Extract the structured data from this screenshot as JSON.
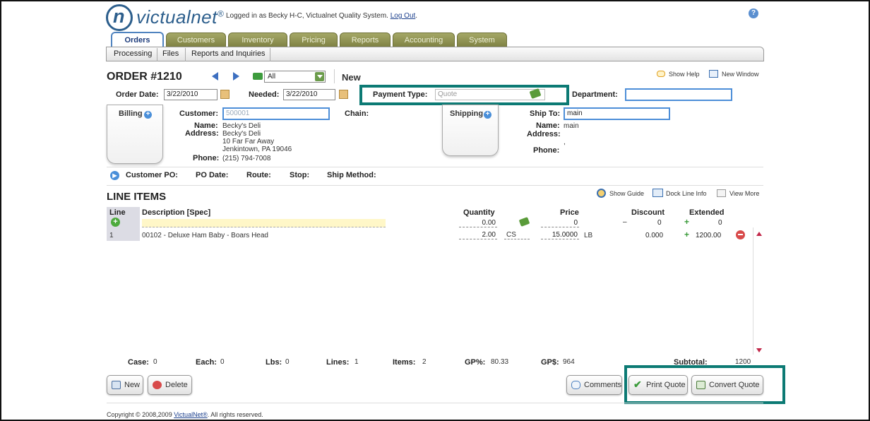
{
  "header": {
    "logo_n": "n",
    "logo_text": "victualnet",
    "logo_reg": "®",
    "login_text": "Logged in as Becky H-C, Victualnet Quality System.",
    "logout_label": "Log Out",
    "help_glyph": "?"
  },
  "tabs": [
    {
      "label": "Orders",
      "active": true
    },
    {
      "label": "Customers"
    },
    {
      "label": "Inventory"
    },
    {
      "label": "Pricing"
    },
    {
      "label": "Reports"
    },
    {
      "label": "Accounting"
    },
    {
      "label": "System"
    }
  ],
  "subnav": [
    "Processing",
    "Files",
    "Reports and Inquiries"
  ],
  "order": {
    "title": "ORDER #1210",
    "filter_value": "All",
    "status": "New",
    "show_help": "Show Help",
    "new_window": "New Window",
    "order_date_label": "Order Date:",
    "order_date": "3/22/2010",
    "needed_label": "Needed:",
    "needed": "3/22/2010",
    "payment_type_label": "Payment Type:",
    "payment_type_placeholder": "Quote",
    "department_label": "Department:",
    "department": ""
  },
  "billing": {
    "tab_label": "Billing",
    "customer_label": "Customer:",
    "customer_placeholder": "500001",
    "name_label": "Name:",
    "name": "Becky's Deli",
    "address_label": "Address:",
    "address_1": "Becky's Deli",
    "address_2": "10 Far Far Away",
    "address_3": "Jenkintown, PA 19046",
    "phone_label": "Phone:",
    "phone": "(215) 794-7008",
    "chain_label": "Chain:"
  },
  "shipping": {
    "tab_label": "Shipping",
    "ship_to_label": "Ship To:",
    "ship_to": "main",
    "name_label": "Name:",
    "name": "main",
    "address_label": "Address:",
    "address_value": ",",
    "phone_label": "Phone:"
  },
  "extra_fields": {
    "customer_po": "Customer PO:",
    "po_date": "PO Date:",
    "route": "Route:",
    "stop": "Stop:",
    "ship_method": "Ship Method:"
  },
  "line_items": {
    "title": "LINE ITEMS",
    "show_guide": "Show Guide",
    "dock_line_info": "Dock Line Info",
    "view_more": "View More",
    "columns": {
      "line": "Line",
      "description": "Description [Spec]",
      "quantity": "Quantity",
      "price": "Price",
      "discount": "Discount",
      "extended": "Extended"
    },
    "new_row": {
      "quantity": "0.00",
      "price": "0",
      "discount_sign": "–",
      "discount": "0",
      "extended": "0"
    },
    "rows": [
      {
        "line": "1",
        "description": "00102 - Deluxe Ham Baby - Boars Head",
        "quantity": "2.00",
        "unit": "CS",
        "price": "15.0000",
        "price_unit": "LB",
        "discount": "0.000",
        "extended": "1200.00"
      }
    ]
  },
  "totals": {
    "case_label": "Case:",
    "case": "0",
    "each_label": "Each:",
    "each": "0",
    "lbs_label": "Lbs:",
    "lbs": "0",
    "lines_label": "Lines:",
    "lines": "1",
    "items_label": "Items:",
    "items": "2",
    "gp_pct_label": "GP%:",
    "gp_pct": "80.33",
    "gp_dollar_label": "GP$:",
    "gp_dollar": "964",
    "subtotal_label": "Subtotal:",
    "subtotal": "1200"
  },
  "buttons": {
    "new": "New",
    "delete": "Delete",
    "comments": "Comments",
    "print_quote": "Print Quote",
    "convert_quote": "Convert Quote"
  },
  "footer": {
    "copyright_prefix": "Copyright © 2008,2009",
    "copyright_link": "VictualNet®",
    "copyright_suffix": ". All rights reserved."
  },
  "colors": {
    "highlight": "#0c7a74",
    "tab_active_border": "#4f83bf",
    "tab_bg": "#8f9350"
  }
}
